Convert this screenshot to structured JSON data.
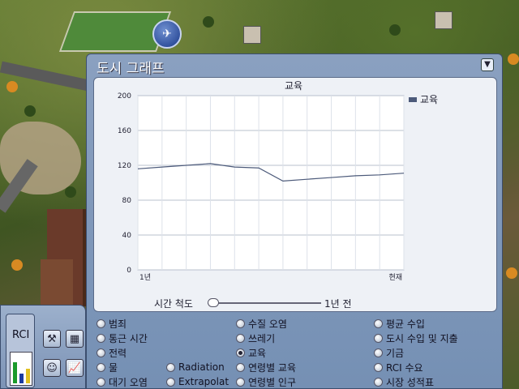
{
  "window": {
    "title": "도시 그래프",
    "collapse_icon": "chevron-down-icon"
  },
  "chart_data": {
    "type": "line",
    "title": "교육",
    "x": [
      0,
      1,
      2,
      3,
      4,
      5,
      6,
      7,
      8,
      9,
      10,
      11
    ],
    "x_tick_labels": [
      "1년",
      "현재"
    ],
    "series": [
      {
        "name": "교육",
        "values": [
          116,
          118,
          120,
          122,
          118,
          117,
          102,
          104,
          106,
          108,
          109,
          111
        ]
      }
    ],
    "ylim": [
      0,
      200
    ],
    "yticks": [
      0,
      40,
      80,
      120,
      160,
      200
    ],
    "grid": true,
    "legend": "top-right",
    "line_color": "#4c5a7a"
  },
  "scale": {
    "label": "시간 척도",
    "value": "1년 전",
    "slider_fraction": 0
  },
  "options": [
    {
      "label": "범죄",
      "checked": false
    },
    {
      "label": "통근 시간",
      "checked": false
    },
    {
      "label": "전력",
      "checked": false
    },
    {
      "label": "물",
      "checked": false
    },
    {
      "label": "대기 오염",
      "checked": false
    },
    {
      "label": "Radiation",
      "checked": false
    },
    {
      "label": "Extrapolat",
      "checked": false
    },
    {
      "label": "수질 오염",
      "checked": false
    },
    {
      "label": "쓰레기",
      "checked": false
    },
    {
      "label": "교육",
      "checked": true
    },
    {
      "label": "연령별 교육",
      "checked": false
    },
    {
      "label": "연령별 인구",
      "checked": false
    },
    {
      "label": "평균 수입",
      "checked": false
    },
    {
      "label": "도시 수입 및 지출",
      "checked": false
    },
    {
      "label": "기금",
      "checked": false
    },
    {
      "label": "RCI 수요",
      "checked": false
    },
    {
      "label": "시장 성적표",
      "checked": false
    }
  ],
  "toolbar": {
    "rci_label": "RCI",
    "rci_colors": [
      "#1a9a2a",
      "#1a3aa0",
      "#e0c020"
    ],
    "tools": [
      "hammer-icon",
      "grid-icon",
      "advisor-icon",
      "graph-icon"
    ]
  }
}
